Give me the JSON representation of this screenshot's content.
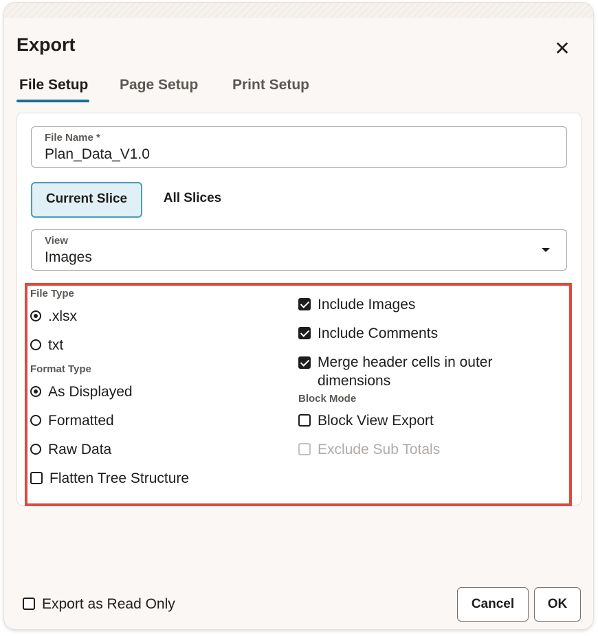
{
  "dialog": {
    "title": "Export",
    "close_icon": "close-icon"
  },
  "tabs": [
    {
      "label": "File Setup",
      "active": true
    },
    {
      "label": "Page Setup",
      "active": false
    },
    {
      "label": "Print Setup",
      "active": false
    }
  ],
  "file_name": {
    "label": "File Name *",
    "value": "Plan_Data_V1.0"
  },
  "slice_toggle": {
    "options": [
      "Current Slice",
      "All Slices"
    ],
    "selected": "Current Slice"
  },
  "view": {
    "label": "View",
    "value": "Images"
  },
  "file_type": {
    "label": "File Type",
    "options": [
      {
        "label": ".xlsx",
        "selected": true
      },
      {
        "label": "txt",
        "selected": false
      }
    ]
  },
  "format_type": {
    "label": "Format Type",
    "options": [
      {
        "label": "As Displayed",
        "selected": true
      },
      {
        "label": "Formatted",
        "selected": false
      },
      {
        "label": "Raw Data",
        "selected": false
      }
    ]
  },
  "flatten": {
    "label": "Flatten Tree Structure",
    "checked": false
  },
  "include": [
    {
      "label": "Include Images",
      "checked": true
    },
    {
      "label": "Include Comments",
      "checked": true
    },
    {
      "label": "Merge header cells in outer dimensions",
      "checked": true
    }
  ],
  "block_mode": {
    "label": "Block Mode",
    "options": [
      {
        "label": "Block View Export",
        "checked": false,
        "disabled": false
      },
      {
        "label": "Exclude Sub Totals",
        "checked": false,
        "disabled": true
      }
    ]
  },
  "footer": {
    "read_only": {
      "label": "Export as Read Only",
      "checked": false
    },
    "cancel_label": "Cancel",
    "ok_label": "OK"
  },
  "colors": {
    "accent": "#1d6e92",
    "highlight_border": "#dd4b3e",
    "selected_segment_bg": "#e0f0f6"
  }
}
